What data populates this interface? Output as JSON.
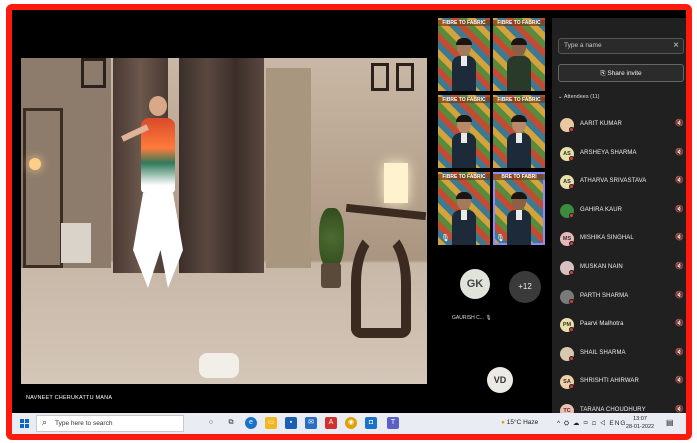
{
  "meeting": {
    "speaker_name": "NAVNEET CHERUKATTU MANA"
  },
  "grid": {
    "banner_text": "FIBRE TO FABRIC",
    "banner_short": "BRE TO FABRI",
    "gk_initials": "GK",
    "gk_label": "GAURISH C...",
    "overflow_count": "+12",
    "vd_initials": "VD"
  },
  "panel": {
    "search_placeholder": "Type a name",
    "share_invite": "Share invite",
    "attendees_heading": "Attendees (11)",
    "attendees": [
      {
        "initials": "",
        "name": "AARIT KUMAR",
        "color": "#e8c8a0"
      },
      {
        "initials": "AS",
        "name": "ARSHEYA SHARMA",
        "color": "#e8e0a8"
      },
      {
        "initials": "AS",
        "name": "ATHARVA SRIVASTAVA",
        "color": "#e8e0a8"
      },
      {
        "initials": "",
        "name": "GAHIRA KAUR",
        "color": "#3c8a3c"
      },
      {
        "initials": "MS",
        "name": "MISHIKA SINGHAL",
        "color": "#e8b8b8"
      },
      {
        "initials": "",
        "name": "MUSKAN NAIN",
        "color": "#d8c0c0"
      },
      {
        "initials": "",
        "name": "PARTH SHARMA",
        "color": "#7a7a7a"
      },
      {
        "initials": "PM",
        "name": "Paarvi Malhotra",
        "color": "#e8e0a8"
      },
      {
        "initials": "",
        "name": "SHAIL SHARMA",
        "color": "#d8c8b0"
      },
      {
        "initials": "SA",
        "name": "SHRISHTI AHIRWAR",
        "color": "#f0d0a8"
      },
      {
        "initials": "TC",
        "name": "TARANA CHOUDHURY",
        "color": "#f0c0b0"
      }
    ]
  },
  "taskbar": {
    "search_placeholder": "Type here to search",
    "weather": "15°C  Haze",
    "language": "ENG",
    "time": "13:07",
    "date": "28-01-2022"
  },
  "colors": {
    "border": "#ff1a0d",
    "panel_bg": "#202020",
    "selected_tile": "#8b8cf7"
  }
}
